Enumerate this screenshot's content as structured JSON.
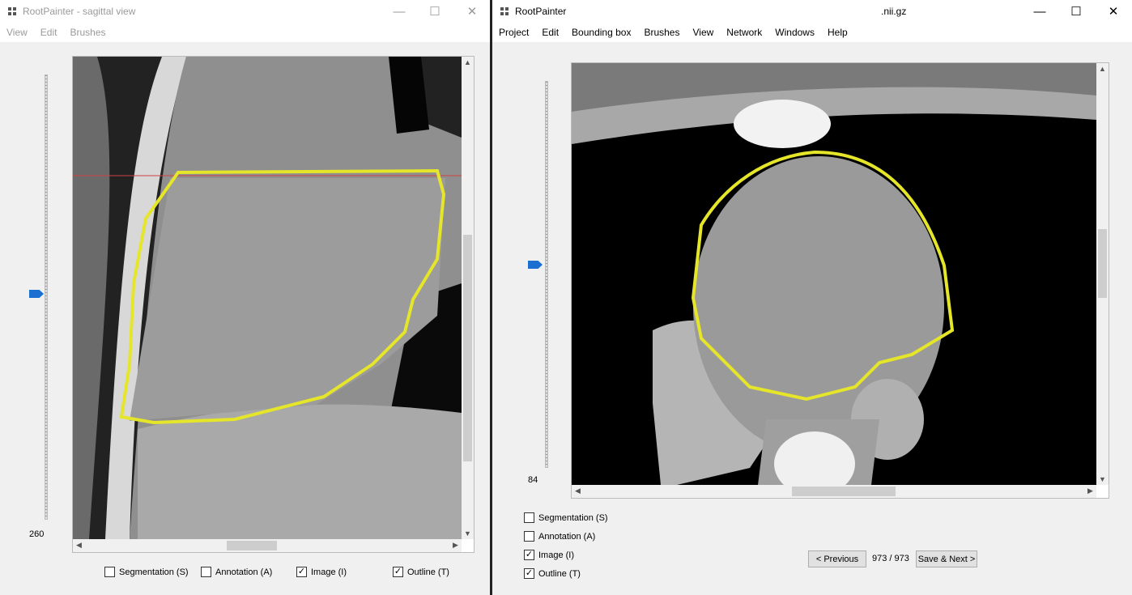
{
  "left_window": {
    "title": "RootPainter - sagittal view",
    "menu": [
      "View",
      "Edit",
      "Brushes"
    ],
    "slice_value": "260",
    "slider_position_fraction": 0.49,
    "checkboxes": [
      {
        "label": "Segmentation (S)",
        "checked": false
      },
      {
        "label": "Annotation (A)",
        "checked": false
      },
      {
        "label": "Image (I)",
        "checked": true
      },
      {
        "label": "Outline (T)",
        "checked": true
      }
    ]
  },
  "right_window": {
    "title": "RootPainter",
    "file": ".nii.gz",
    "menu": [
      "Project",
      "Edit",
      "Bounding box",
      "Brushes",
      "View",
      "Network",
      "Windows",
      "Help"
    ],
    "slice_value": "84",
    "slider_position_fraction": 0.47,
    "checkboxes": [
      {
        "label": "Segmentation (S)",
        "checked": false
      },
      {
        "label": "Annotation (A)",
        "checked": false
      },
      {
        "label": "Image (I)",
        "checked": true
      },
      {
        "label": "Outline (T)",
        "checked": true
      }
    ],
    "previous_label": "< Previous",
    "counter": "973 / 973",
    "next_label": "Save & Next >"
  },
  "colors": {
    "outline": "#e5e52a",
    "handle": "#1a6fd0"
  }
}
